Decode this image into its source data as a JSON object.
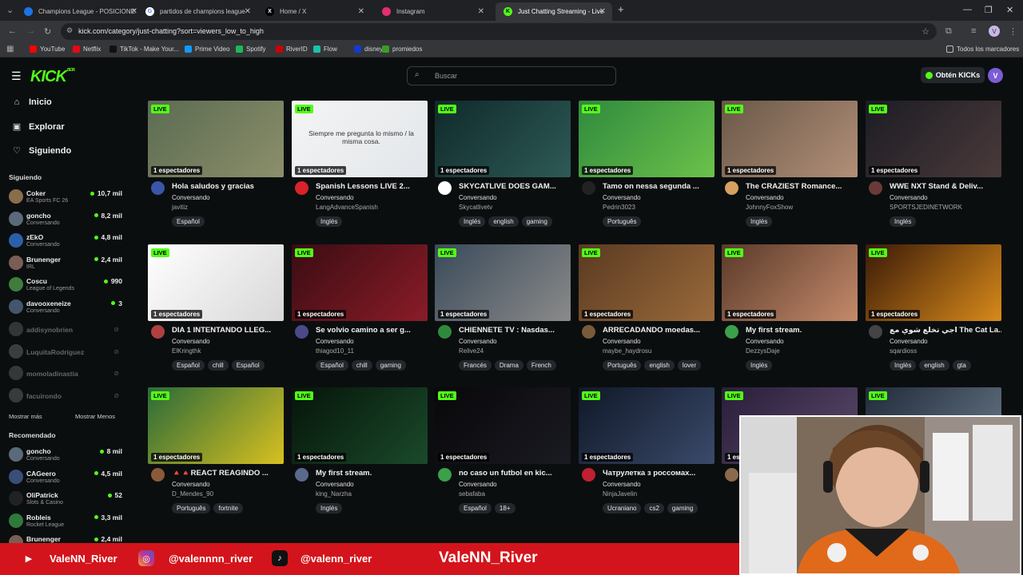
{
  "browser": {
    "tabs": [
      {
        "label": "Champions League - POSICIONES",
        "fav_color": "#1a73e8",
        "fav_glyph": "",
        "active": false
      },
      {
        "label": "partidos de champions league",
        "fav_color": "#ffffff",
        "fav_glyph": "G",
        "active": false
      },
      {
        "label": "Home / X",
        "fav_color": "#000000",
        "fav_glyph": "X",
        "active": false
      },
      {
        "label": "Instagram",
        "fav_color": "#e1306c",
        "fav_glyph": "",
        "active": false
      },
      {
        "label": "Just Chatting Streaming - Live on Kick",
        "fav_color": "#53fc18",
        "fav_glyph": "K",
        "active": true
      }
    ],
    "new_tab": "+",
    "url": "kick.com/category/just-chatting?sort=viewers_low_to_high",
    "bookmarks": [
      {
        "label": "YouTube",
        "color": "#ff0000"
      },
      {
        "label": "Netflix",
        "color": "#e50914"
      },
      {
        "label": "TikTok - Make Your...",
        "color": "#111111"
      },
      {
        "label": "Prime Video",
        "color": "#1399ff"
      },
      {
        "label": "Spotify",
        "color": "#1db954"
      },
      {
        "label": "RiverID",
        "color": "#cc0000"
      },
      {
        "label": "Flow",
        "color": "#19c3a5"
      },
      {
        "label": "disney",
        "color": "#113ccf"
      },
      {
        "label": "promiedos",
        "color": "#3a9d23"
      }
    ],
    "all_bookmarks": "Todos los marcadores"
  },
  "header": {
    "logo": "KICK",
    "logo_beta": "BETA",
    "search_placeholder": "Buscar",
    "get_kicks": "Obtén KICKs"
  },
  "sidebar": {
    "nav": [
      {
        "label": "Inicio",
        "icon": "home-icon"
      },
      {
        "label": "Explorar",
        "icon": "compass-icon"
      },
      {
        "label": "Siguiendo",
        "icon": "heart-icon"
      }
    ],
    "following_title": "Siguiendo",
    "following": [
      {
        "name": "Coker",
        "category": "EA Sports FC 26",
        "viewers": "10,7 mil",
        "color": "#8a6d4a",
        "online": true
      },
      {
        "name": "goncho",
        "category": "Conversando",
        "viewers": "8,2 mil",
        "color": "#5a6a7a",
        "online": true
      },
      {
        "name": "zEkO",
        "category": "Conversando",
        "viewers": "4,8 mil",
        "color": "#2b5fa8",
        "online": true
      },
      {
        "name": "Brunenger",
        "category": "IRL",
        "viewers": "2,4 mil",
        "color": "#7a5d55",
        "online": true
      },
      {
        "name": "Coscu",
        "category": "League of Legends",
        "viewers": "990",
        "color": "#3f7d3a",
        "online": true
      },
      {
        "name": "davooxeneize",
        "category": "Conversando",
        "viewers": "3",
        "color": "#44566e",
        "online": true
      },
      {
        "name": "addisynobrien",
        "category": "",
        "viewers": "",
        "color": "#666666",
        "online": false
      },
      {
        "name": "LuquitaRodriguez",
        "category": "",
        "viewers": "",
        "color": "#777777",
        "online": false
      },
      {
        "name": "momoladinastia",
        "category": "",
        "viewers": "",
        "color": "#6a6a6a",
        "online": false
      },
      {
        "name": "facuirondo",
        "category": "",
        "viewers": "",
        "color": "#707070",
        "online": false
      }
    ],
    "show_more": "Mostrar más",
    "show_less": "Mostrar Menos",
    "recommended_title": "Recomendado",
    "recommended": [
      {
        "name": "goncho",
        "category": "Conversando",
        "viewers": "8 mil",
        "color": "#5a6a7a"
      },
      {
        "name": "CAGeero",
        "category": "Conversando",
        "viewers": "4,5 mil",
        "color": "#3a4e7a"
      },
      {
        "name": "OliPatrick",
        "category": "Slots & Casino",
        "viewers": "52",
        "color": "#222222"
      },
      {
        "name": "Robleis",
        "category": "Rocket League",
        "viewers": "3,3 mil",
        "color": "#2f7a3a"
      },
      {
        "name": "Brunenger",
        "category": "",
        "viewers": "2,4 mil",
        "color": "#7a5d55"
      }
    ]
  },
  "grid": {
    "live_label": "LIVE",
    "cards": [
      {
        "title": "Hola saludos y gracias",
        "category": "Conversando",
        "user": "javitiz",
        "viewers": "1 espectadores",
        "tags": [
          "Español"
        ],
        "thumb": [
          "#5b6b52",
          "#8c8f6a"
        ],
        "av": "#3a56a8"
      },
      {
        "title": "Spanish Lessons LIVE 2...",
        "category": "Conversando",
        "user": "LangAdvanceSpanish",
        "viewers": "1 espectadores",
        "tags": [
          "Inglés"
        ],
        "thumb": [
          "#f4f4f4",
          "#e2e6ea"
        ],
        "av": "#d9222a",
        "thumb_text": "Siempre me pregunta lo mismo / la misma cosa."
      },
      {
        "title": "SKYCATLIVE DOES GAM...",
        "category": "Conversando",
        "user": "Skycatlivetv",
        "viewers": "1 espectadores",
        "tags": [
          "Inglés",
          "english",
          "gaming"
        ],
        "thumb": [
          "#0f2a2a",
          "#2e5a55"
        ],
        "av": "#ffffff"
      },
      {
        "title": "Tamo on nessa segunda ...",
        "category": "Conversando",
        "user": "Pedrin3023",
        "viewers": "1 espectadores",
        "tags": [
          "Português"
        ],
        "thumb": [
          "#2f8a3e",
          "#6cc24a"
        ],
        "av": "#222222"
      },
      {
        "title": "The CRAZIEST Romance...",
        "category": "Conversando",
        "user": "JohnnyFoxShow",
        "viewers": "1 espectadores",
        "tags": [
          "Inglés"
        ],
        "thumb": [
          "#6a5848",
          "#b28f78"
        ],
        "av": "#d6a060"
      },
      {
        "title": "WWE NXT Stand & Deliv...",
        "category": "Conversando",
        "user": "SPORTSJEDINETWORK",
        "viewers": "1 espectadores",
        "tags": [
          "Inglés"
        ],
        "thumb": [
          "#1c1c24",
          "#4a3a3a"
        ],
        "av": "#6a3a3a"
      },
      {
        "title": "DIA 1 INTENTANDO LLEG...",
        "category": "Conversando",
        "user": "ElKringthk",
        "viewers": "1 espectadores",
        "tags": [
          "Español",
          "chill",
          "Español"
        ],
        "thumb": [
          "#ffffff",
          "#d8d8d8"
        ],
        "av": "#b04040"
      },
      {
        "title": "Se volvio camino a ser g...",
        "category": "Conversando",
        "user": "thiagod10_11",
        "viewers": "1 espectadores",
        "tags": [
          "Español",
          "chill",
          "gaming"
        ],
        "thumb": [
          "#3a0c12",
          "#8a1c28"
        ],
        "av": "#4a4a8a"
      },
      {
        "title": "CHIENNETE TV : Nasdas...",
        "category": "Conversando",
        "user": "Relive24",
        "viewers": "1 espectadores",
        "tags": [
          "Francés",
          "Drama",
          "French"
        ],
        "thumb": [
          "#3a4a5a",
          "#8a8a8a"
        ],
        "av": "#2e8a3a"
      },
      {
        "title": "ARRECADANDO moedas...",
        "category": "Conversando",
        "user": "maybe_haydrosu",
        "viewers": "1 espectadores",
        "tags": [
          "Português",
          "english",
          "lover"
        ],
        "thumb": [
          "#5a3a22",
          "#9a6a3a"
        ],
        "av": "#7a5a3a"
      },
      {
        "title": "My first stream.",
        "category": "Conversando",
        "user": "DezzysDaje",
        "viewers": "1 espectadores",
        "tags": [
          "Inglés"
        ],
        "thumb": [
          "#5a3a2a",
          "#c48a6a"
        ],
        "av": "#3aa04a"
      },
      {
        "title": "اجي تخلع شوي مع The Cat La...",
        "category": "Conversando",
        "user": "sqardioss",
        "viewers": "1 espectadores",
        "tags": [
          "Inglés",
          "english",
          "gta"
        ],
        "thumb": [
          "#3a1a08",
          "#d88a1a"
        ],
        "av": "#444444"
      },
      {
        "title": "🔺🔺REACT REAGINDO ...",
        "category": "Conversando",
        "user": "D_Mendes_90",
        "viewers": "1 espectadores",
        "tags": [
          "Português",
          "fortnite"
        ],
        "thumb": [
          "#2a6a3a",
          "#d8c020"
        ],
        "av": "#8a5a3a"
      },
      {
        "title": "My first stream.",
        "category": "Conversando",
        "user": "king_Narzha",
        "viewers": "1 espectadores",
        "tags": [
          "Inglés"
        ],
        "thumb": [
          "#06140a",
          "#1a4a2a"
        ],
        "av": "#5a6a8a"
      },
      {
        "title": "no caso un futbol en kic...",
        "category": "Conversando",
        "user": "sebafaba",
        "viewers": "1 espectadores",
        "tags": [
          "Español",
          "18+"
        ],
        "thumb": [
          "#08080a",
          "#1a1a22"
        ],
        "av": "#3aa04a"
      },
      {
        "title": "Чатрулетка з россомах...",
        "category": "Conversando",
        "user": "NinjaJavelin",
        "viewers": "1 espectadores",
        "tags": [
          "Ucraniano",
          "cs2",
          "gaming"
        ],
        "thumb": [
          "#101828",
          "#3a4a6a"
        ],
        "av": "#c02030"
      },
      {
        "title": "",
        "category": "",
        "user": "",
        "viewers": "1 es",
        "tags": [],
        "thumb": [
          "#2a1e3a",
          "#5a4a6a"
        ],
        "av": "#8a6a4a"
      },
      {
        "title": "",
        "category": "",
        "user": "",
        "viewers": "",
        "tags": [],
        "thumb": [
          "#202a3a",
          "#6a7a8a"
        ],
        "av": "#555555"
      }
    ]
  },
  "overlay": {
    "handles": [
      {
        "platform": "youtube-icon",
        "handle": "ValeNN_River",
        "color": "#ff0000"
      },
      {
        "platform": "instagram-icon",
        "handle": "@valennnn_river",
        "color": "#c13584"
      },
      {
        "platform": "tiktok-icon",
        "handle": "@valenn_river",
        "color": "#111111"
      }
    ],
    "big_name": "ValeNN_River"
  }
}
